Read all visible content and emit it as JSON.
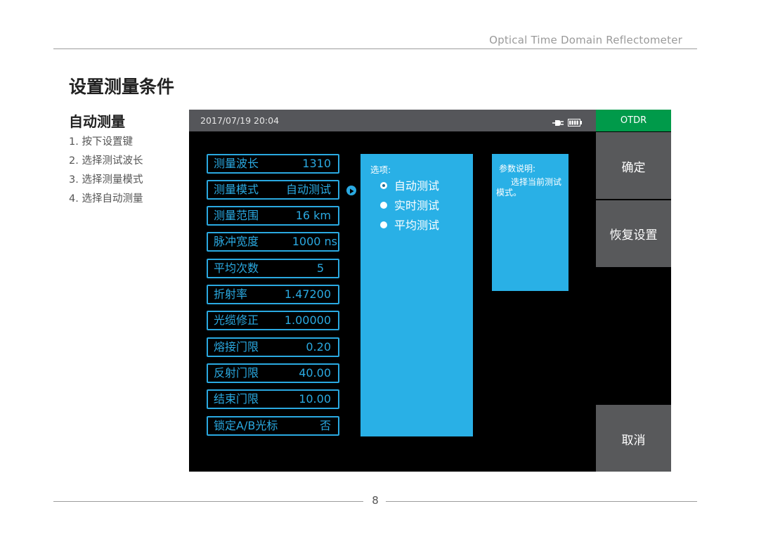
{
  "doc": {
    "header_title": "Optical Time Domain Reflectometer",
    "section_title": "设置测量条件",
    "subsection_title": "自动测量",
    "steps": [
      "1. 按下设置键",
      "2. 选择测试波长",
      "3. 选择测量模式",
      "4. 选择自动测量"
    ],
    "page_number": "8"
  },
  "device": {
    "datetime": "2017/07/19  20:04",
    "status_icons": [
      "plug-icon",
      "battery-icon"
    ],
    "mode_tab": "OTDR",
    "params": [
      {
        "label": "测量波长",
        "value": "1310"
      },
      {
        "label": "测量模式",
        "value": "自动测试"
      },
      {
        "label": "测量范围",
        "value": "16 km"
      },
      {
        "label": "脉冲宽度",
        "value": "1000 ns"
      },
      {
        "label": "平均次数",
        "value": "5"
      },
      {
        "label": "折射率",
        "value": "1.47200"
      },
      {
        "label": "光缆修正",
        "value": "1.00000"
      },
      {
        "label": "熔接门限",
        "value": "0.20"
      },
      {
        "label": "反射门限",
        "value": "40.00"
      },
      {
        "label": "结束门限",
        "value": "10.00"
      },
      {
        "label": "锁定A/B光标",
        "value": "否"
      }
    ],
    "options": {
      "title": "选项:",
      "items": [
        {
          "label": "自动测试",
          "selected": true
        },
        {
          "label": "实时测试",
          "selected": false
        },
        {
          "label": "平均测试",
          "selected": false
        }
      ]
    },
    "description": {
      "title": "参数说明:",
      "text": "选择当前测试模式。"
    },
    "buttons": {
      "confirm": "确定",
      "restore": "恢复设置",
      "cancel": "取消"
    },
    "colors": {
      "accent": "#2aa9e1",
      "panel": "#29b0e6",
      "mode_tab": "#009a4a",
      "side_button": "#58595b",
      "status_bar": "#55565a"
    }
  }
}
